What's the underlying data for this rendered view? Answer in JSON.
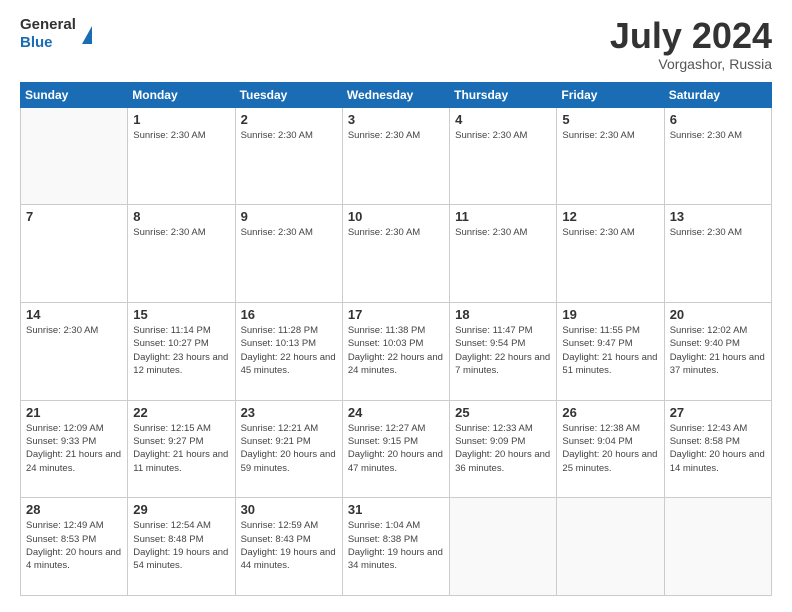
{
  "header": {
    "logo": {
      "line1": "General",
      "line2": "Blue"
    },
    "title": "July 2024",
    "location": "Vorgashor, Russia"
  },
  "days_of_week": [
    "Sunday",
    "Monday",
    "Tuesday",
    "Wednesday",
    "Thursday",
    "Friday",
    "Saturday"
  ],
  "weeks": [
    [
      {
        "day": "",
        "info": ""
      },
      {
        "day": "1",
        "info": "Sunrise: 2:30 AM"
      },
      {
        "day": "2",
        "info": "Sunrise: 2:30 AM"
      },
      {
        "day": "3",
        "info": "Sunrise: 2:30 AM"
      },
      {
        "day": "4",
        "info": "Sunrise: 2:30 AM"
      },
      {
        "day": "5",
        "info": "Sunrise: 2:30 AM"
      },
      {
        "day": "6",
        "info": "Sunrise: 2:30 AM"
      }
    ],
    [
      {
        "day": "7",
        "info": ""
      },
      {
        "day": "8",
        "info": "Sunrise: 2:30 AM"
      },
      {
        "day": "9",
        "info": "Sunrise: 2:30 AM"
      },
      {
        "day": "10",
        "info": "Sunrise: 2:30 AM"
      },
      {
        "day": "11",
        "info": "Sunrise: 2:30 AM"
      },
      {
        "day": "12",
        "info": "Sunrise: 2:30 AM"
      },
      {
        "day": "13",
        "info": "Sunrise: 2:30 AM"
      }
    ],
    [
      {
        "day": "14",
        "info": "Sunrise: 2:30 AM"
      },
      {
        "day": "15",
        "info": "Sunrise: 11:14 PM\nSunset: 10:27 PM\nDaylight: 23 hours and 12 minutes."
      },
      {
        "day": "16",
        "info": "Sunrise: 11:28 PM\nSunset: 10:13 PM\nDaylight: 22 hours and 45 minutes."
      },
      {
        "day": "17",
        "info": "Sunrise: 11:38 PM\nSunset: 10:03 PM\nDaylight: 22 hours and 24 minutes."
      },
      {
        "day": "18",
        "info": "Sunrise: 11:47 PM\nSunset: 9:54 PM\nDaylight: 22 hours and 7 minutes."
      },
      {
        "day": "19",
        "info": "Sunrise: 11:55 PM\nSunset: 9:47 PM\nDaylight: 21 hours and 51 minutes."
      },
      {
        "day": "20",
        "info": "Sunrise: 12:02 AM\nSunset: 9:40 PM\nDaylight: 21 hours and 37 minutes."
      }
    ],
    [
      {
        "day": "21",
        "info": "Sunrise: 12:09 AM\nSunset: 9:33 PM\nDaylight: 21 hours and 24 minutes."
      },
      {
        "day": "22",
        "info": "Sunrise: 12:15 AM\nSunset: 9:27 PM\nDaylight: 21 hours and 11 minutes."
      },
      {
        "day": "23",
        "info": "Sunrise: 12:21 AM\nSunset: 9:21 PM\nDaylight: 20 hours and 59 minutes."
      },
      {
        "day": "24",
        "info": "Sunrise: 12:27 AM\nSunset: 9:15 PM\nDaylight: 20 hours and 47 minutes."
      },
      {
        "day": "25",
        "info": "Sunrise: 12:33 AM\nSunset: 9:09 PM\nDaylight: 20 hours and 36 minutes."
      },
      {
        "day": "26",
        "info": "Sunrise: 12:38 AM\nSunset: 9:04 PM\nDaylight: 20 hours and 25 minutes."
      },
      {
        "day": "27",
        "info": "Sunrise: 12:43 AM\nSunset: 8:58 PM\nDaylight: 20 hours and 14 minutes."
      }
    ],
    [
      {
        "day": "28",
        "info": "Sunrise: 12:49 AM\nSunset: 8:53 PM\nDaylight: 20 hours and 4 minutes."
      },
      {
        "day": "29",
        "info": "Sunrise: 12:54 AM\nSunset: 8:48 PM\nDaylight: 19 hours and 54 minutes."
      },
      {
        "day": "30",
        "info": "Sunrise: 12:59 AM\nSunset: 8:43 PM\nDaylight: 19 hours and 44 minutes."
      },
      {
        "day": "31",
        "info": "Sunrise: 1:04 AM\nSunset: 8:38 PM\nDaylight: 19 hours and 34 minutes."
      },
      {
        "day": "",
        "info": ""
      },
      {
        "day": "",
        "info": ""
      },
      {
        "day": "",
        "info": ""
      }
    ]
  ]
}
